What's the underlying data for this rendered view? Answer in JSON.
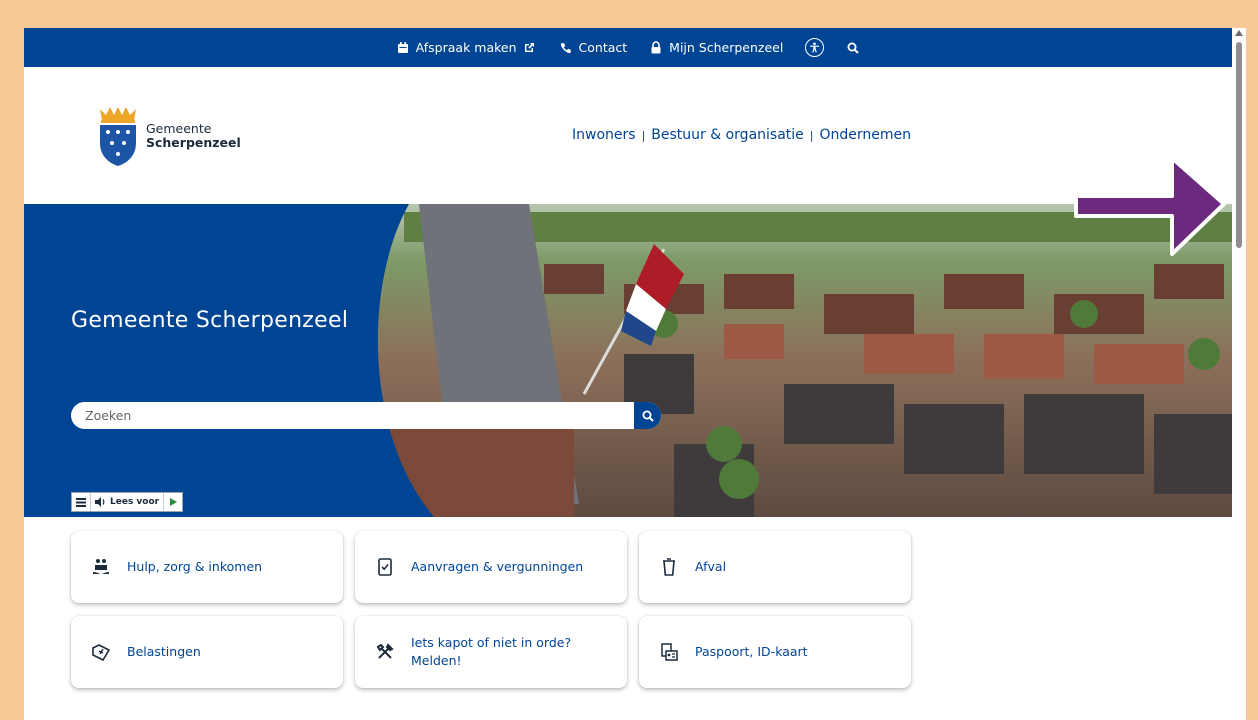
{
  "topbar": {
    "appointment_label": "Afspraak maken",
    "contact_label": "Contact",
    "account_label": "Mijn Scherpenzeel"
  },
  "logo": {
    "line1": "Gemeente",
    "line2": "Scherpenzeel"
  },
  "mainnav": {
    "items": [
      "Inwoners",
      "Bestuur & organisatie",
      "Ondernemen"
    ]
  },
  "hero": {
    "title": "Gemeente Scherpenzeel",
    "search_placeholder": "Zoeken"
  },
  "readspeaker": {
    "label": "Lees voor"
  },
  "tiles": [
    {
      "label": "Hulp, zorg & inkomen",
      "icon": "care-hands-icon"
    },
    {
      "label": "Aanvragen & vergunningen",
      "icon": "document-check-icon"
    },
    {
      "label": "Afval",
      "icon": "waste-bin-icon"
    },
    {
      "label": "Belastingen",
      "icon": "tax-tag-icon"
    },
    {
      "label": "Iets kapot of niet in orde? Melden!",
      "icon": "tools-icon"
    },
    {
      "label": "Paspoort, ID-kaart",
      "icon": "id-card-icon"
    }
  ],
  "colors": {
    "brand_blue": "#004494",
    "frame": "#f6c996",
    "annotation_arrow": "#6b2a7e"
  }
}
